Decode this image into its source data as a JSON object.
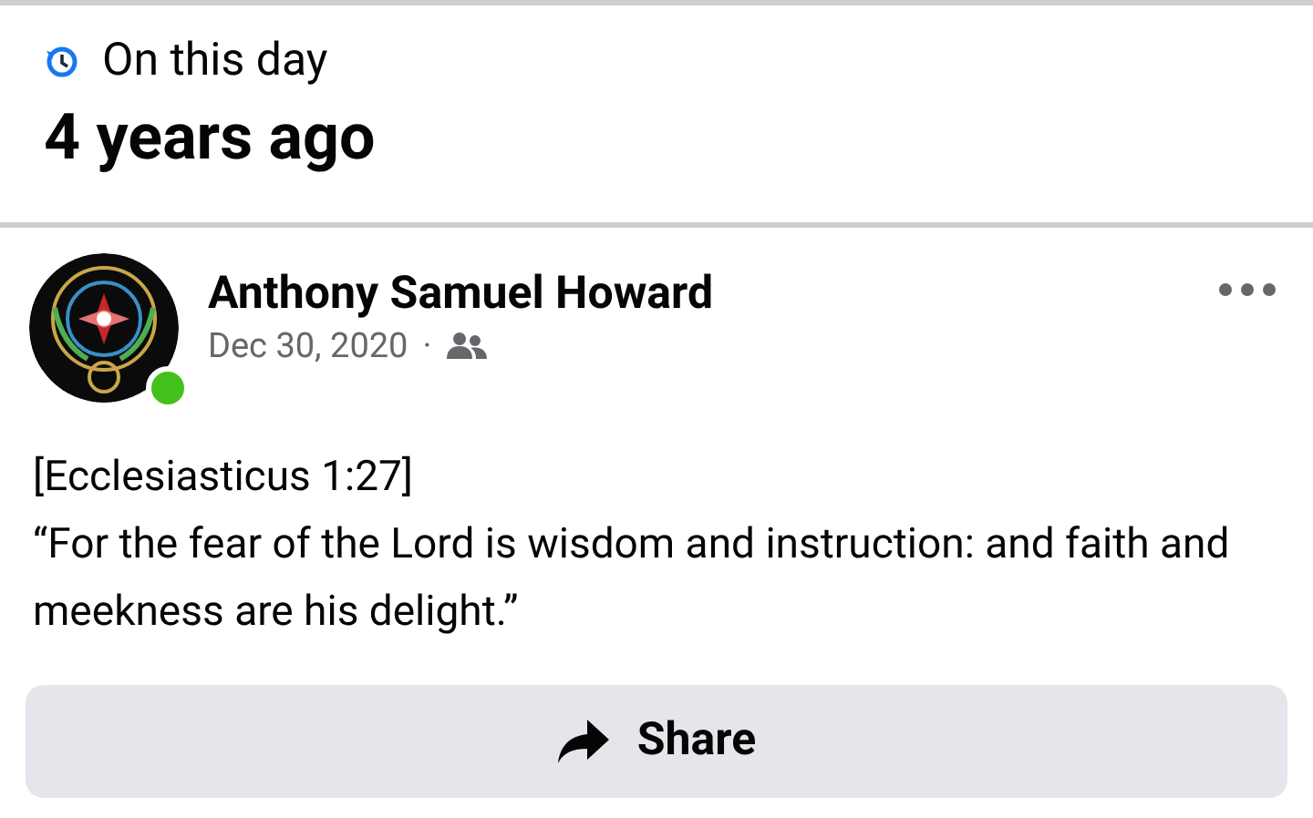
{
  "header": {
    "label": "On this day",
    "title": "4 years ago"
  },
  "post": {
    "author": "Anthony Samuel Howard",
    "online": true,
    "date": "Dec 30, 2020",
    "separator": "·",
    "lines": [
      "[Ecclesiasticus 1:27]",
      "“For the fear of the Lord is wisdom and instruction: and faith and meekness are his delight.”"
    ],
    "share": "Share"
  }
}
